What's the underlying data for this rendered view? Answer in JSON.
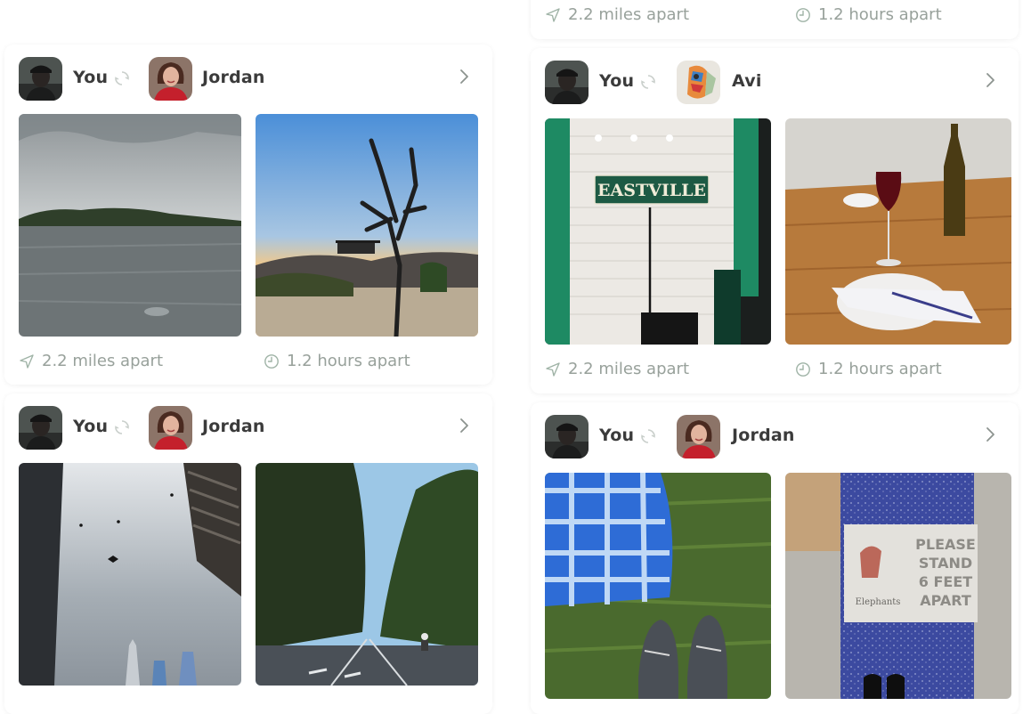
{
  "top_strip": {
    "distance": "2.2 miles apart",
    "time": "1.2 hours apart"
  },
  "cards": [
    {
      "you_label": "You",
      "partner_name": "Jordan",
      "distance": "2.2 miles apart",
      "time": "1.2 hours apart",
      "photos": [
        "lake-photo",
        "joshua-tree-photo"
      ]
    },
    {
      "you_label": "You",
      "partner_name": "Jordan",
      "distance": "",
      "time": "",
      "photos": [
        "skyscrapers-photo",
        "tree-lined-road-photo"
      ]
    },
    {
      "you_label": "You",
      "partner_name": "Avi",
      "distance": "2.2 miles apart",
      "time": "1.2 hours apart",
      "photos": [
        "eastville-stage-photo",
        "wine-table-photo"
      ],
      "sign_text": "EASTVILLE"
    },
    {
      "you_label": "You",
      "partner_name": "Jordan",
      "distance": "",
      "time": "",
      "photos": [
        "plaid-blanket-photo",
        "sidewalk-sign-photo"
      ],
      "sign_lines": [
        "PLEASE",
        "STAND",
        "6 FEET",
        "APART"
      ],
      "sign_brand": "Elephants"
    }
  ],
  "colors": {
    "accent": "#7fa98a",
    "muted_text": "#98a19b",
    "name_text": "#3b3b3b"
  }
}
